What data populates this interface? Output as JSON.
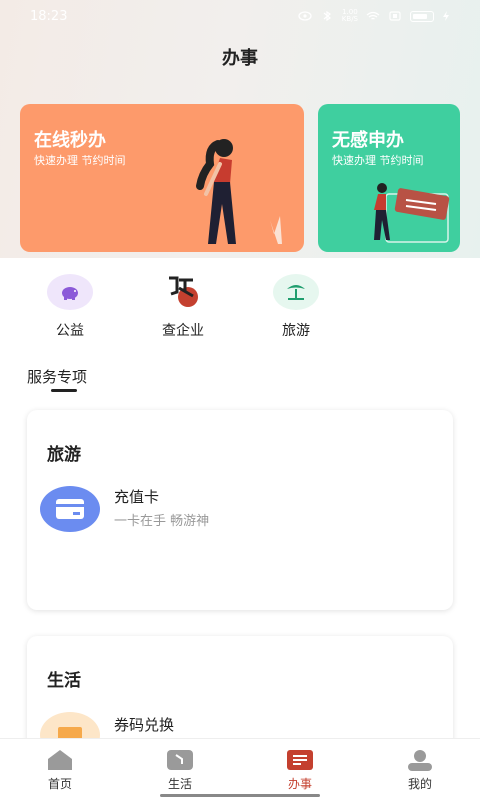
{
  "status_bar": {
    "time": "18:23",
    "network_speed": "1.00\nKB/S",
    "battery_label": "76"
  },
  "header": {
    "title": "办事"
  },
  "banners": [
    {
      "title": "在线秒办",
      "subtitle": "快速办理 节约时间",
      "color": "#fd9a6b"
    },
    {
      "title": "无感申办",
      "subtitle": "快速办理 节约时间",
      "color": "#3fcf9f"
    }
  ],
  "quick_links": [
    {
      "label": "公益",
      "icon": "piggy-bank-icon",
      "bg": "#efe6fb"
    },
    {
      "label": "查企业",
      "icon": "company-logo-icon",
      "bg": "#ffffff"
    },
    {
      "label": "旅游",
      "icon": "palm-island-icon",
      "bg": "#e6f7ef"
    }
  ],
  "section": {
    "label": "服务专项"
  },
  "cards": [
    {
      "title": "旅游",
      "services": [
        {
          "name": "充值卡",
          "desc": "一卡在手 畅游神",
          "icon": "card-icon",
          "icon_color": "#6b8cf0"
        }
      ]
    },
    {
      "title": "生活",
      "services": [
        {
          "name": "券码兑换",
          "desc": "",
          "icon": "coupon-icon",
          "icon_color": "#f6a94b"
        }
      ]
    }
  ],
  "tabbar": {
    "active": "办事",
    "items": [
      {
        "label": "首页",
        "icon": "home-icon"
      },
      {
        "label": "生活",
        "icon": "life-icon"
      },
      {
        "label": "办事",
        "icon": "service-icon"
      },
      {
        "label": "我的",
        "icon": "profile-icon"
      }
    ]
  },
  "colors": {
    "accent": "#c4402f",
    "orange": "#fd9a6b",
    "green": "#3fcf9f"
  }
}
